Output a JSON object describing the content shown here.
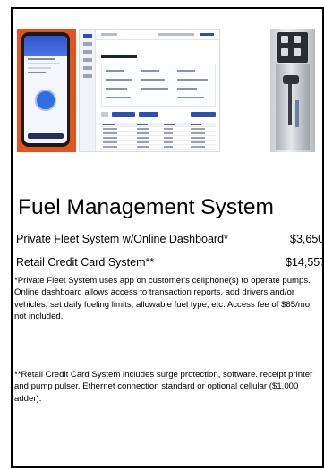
{
  "title": "Fuel Management System",
  "products": [
    {
      "name": "Private Fleet System w/Online Dashboard*",
      "price": "$3,650"
    },
    {
      "name": "Retail Credit Card System**",
      "price": "$14,557"
    }
  ],
  "notes": [
    "*Private Fleet System uses app on customer's cellphone(s) to operate pumps.  Online dashboard allows access to transaction reports, add drivers and/or vehicles, set daily fueling limits, allowable fuel type, etc.  Access fee of $85/mo. not included.",
    "**Retail Credit Card System includes surge protection, software. receipt printer and pump pulser.  Ethernet connection standard or optional cellular ($1,000 adder)."
  ],
  "images": [
    "phone-app-photo",
    "online-dashboard-screenshot",
    "fuel-pump-photo"
  ],
  "colors": {
    "phone_background": "#e2531f",
    "dashboard_accent": "#2b4fb8"
  }
}
